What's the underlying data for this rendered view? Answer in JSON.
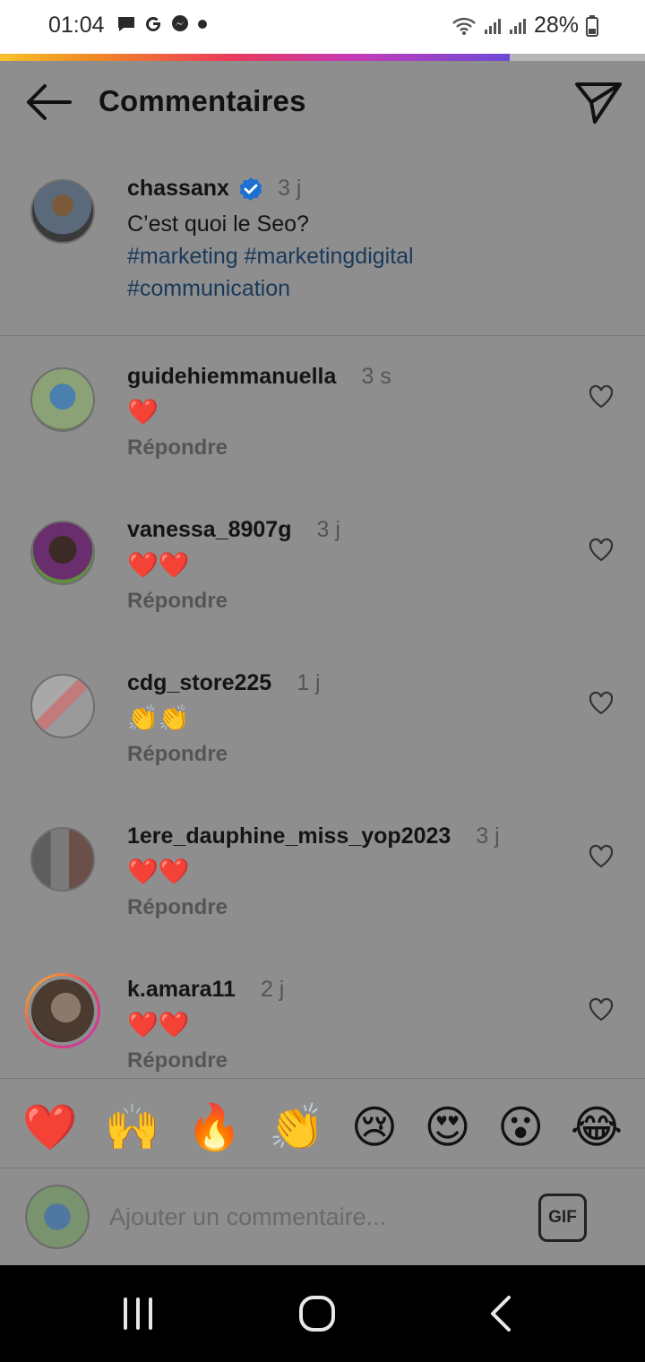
{
  "status_bar": {
    "time": "01:04",
    "battery": "28%",
    "icons": [
      "message-icon",
      "google-icon",
      "messenger-icon",
      "dot-icon",
      "wifi-icon",
      "signal-icon",
      "signal-icon",
      "battery-icon"
    ]
  },
  "progress": {
    "fill_fraction": 0.79
  },
  "header": {
    "title": "Commentaires"
  },
  "caption": {
    "username": "chassanx",
    "verified": true,
    "time": "3 j",
    "text": "C’est quoi le Seo?",
    "hashtags": "#marketing #marketingdigital #communication"
  },
  "comments": [
    {
      "username": "guidehiemmanuella",
      "time": "3 s",
      "text": "❤️",
      "reply_label": "Répondre"
    },
    {
      "username": "vanessa_8907g",
      "time": "3 j",
      "text": "❤️❤️",
      "reply_label": "Répondre"
    },
    {
      "username": "cdg_store225",
      "time": "1 j",
      "text": "👏👏",
      "reply_label": "Répondre"
    },
    {
      "username": "1ere_dauphine_miss_yop2023",
      "time": "3 j",
      "text": "❤️❤️",
      "reply_label": "Répondre"
    },
    {
      "username": "k.amara11",
      "time": "2 j",
      "text": "❤️❤️",
      "reply_label": "Répondre"
    }
  ],
  "quick_emojis": [
    "❤️",
    "🙌",
    "🔥",
    "👏",
    "😢",
    "😍",
    "😮",
    "😂"
  ],
  "composer": {
    "placeholder": "Ajouter un commentaire...",
    "gif_label": "GIF"
  },
  "colors": {
    "hashtag": "#18395a",
    "verified": "#1d6fd1",
    "overlay_bg": "#8e8e8e"
  }
}
